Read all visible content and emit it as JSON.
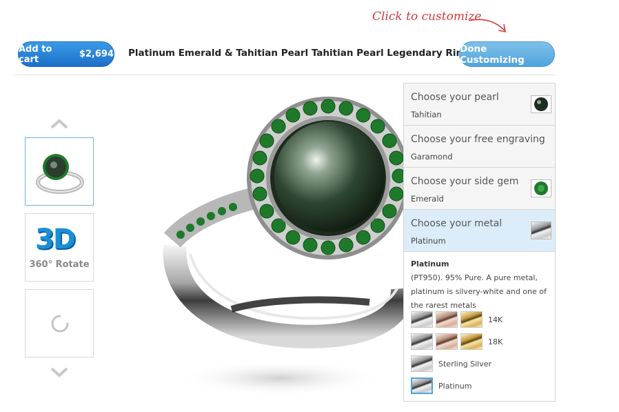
{
  "header": {
    "hint_text": "Click to customize",
    "cart_label": "Add to cart",
    "cart_price": "$2,694",
    "product_title": "Platinum Emerald & Tahitian Pearl Tahitian Pearl Legendary Ring",
    "done_label": "Done Customizing"
  },
  "thumbnails": {
    "rotate_big": "3D",
    "rotate_label": "360° Rotate"
  },
  "options": [
    {
      "title": "Choose your pearl",
      "value": "Tahitian",
      "swatch": "tahitian-pearl"
    },
    {
      "title": "Choose your free engraving",
      "value": "Garamond",
      "swatch": null
    },
    {
      "title": "Choose your side gem",
      "value": "Emerald",
      "swatch": "emerald"
    },
    {
      "title": "Choose your metal",
      "value": "Platinum",
      "swatch": "platinum"
    }
  ],
  "metal_detail": {
    "title": "Platinum",
    "description": "(PT950). 95% Pure. A pure metal, platinum is silvery-white and one of the rarest metals",
    "rows": [
      {
        "label": "14K",
        "swatches": [
          "white-gold",
          "rose-gold",
          "yellow-gold"
        ]
      },
      {
        "label": "18K",
        "swatches": [
          "white-gold",
          "rose-gold",
          "yellow-gold"
        ]
      },
      {
        "label": "Sterling Silver",
        "swatches": [
          "sterling-silver"
        ]
      },
      {
        "label": "Platinum",
        "swatches": [
          "platinum"
        ],
        "selected": true
      }
    ]
  },
  "colors": {
    "cart_blue": "#1c6fc8",
    "done_blue": "#4fa4dc",
    "hint_red": "#d63a3a",
    "active_option_bg": "#dcedf9",
    "emerald": "#1e7a2a"
  }
}
